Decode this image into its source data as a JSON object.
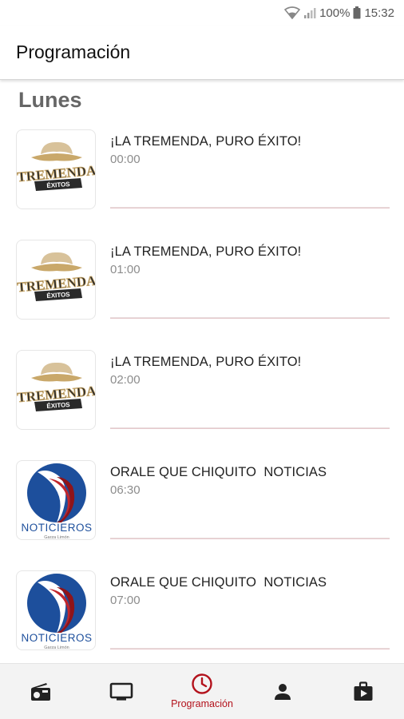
{
  "status_bar": {
    "battery": "100%",
    "time": "15:32",
    "icons": [
      "wifi-icon",
      "signal-icon",
      "battery-icon"
    ]
  },
  "app_bar": {
    "title": "Programación"
  },
  "day_heading": "Lunes",
  "programs": [
    {
      "title": "¡LA TREMENDA, PURO ÉXITO!",
      "time": "00:00",
      "logo": "tremenda-logo",
      "logo_text": "TREMENDA",
      "logo_sub": "ÉXITOS"
    },
    {
      "title": "¡LA TREMENDA, PURO ÉXITO!",
      "time": "01:00",
      "logo": "tremenda-logo",
      "logo_text": "TREMENDA",
      "logo_sub": "ÉXITOS"
    },
    {
      "title": "¡LA TREMENDA, PURO ÉXITO!",
      "time": "02:00",
      "logo": "tremenda-logo",
      "logo_text": "TREMENDA",
      "logo_sub": "ÉXITOS"
    },
    {
      "title": "ORALE QUE CHIQUITO  NOTICIAS",
      "time": "06:30",
      "logo": "noticieros-logo",
      "logo_text": "NOTICIEROS",
      "logo_sub": "Garza Limón"
    },
    {
      "title": "ORALE QUE CHIQUITO  NOTICIAS",
      "time": "07:00",
      "logo": "noticieros-logo",
      "logo_text": "NOTICIEROS",
      "logo_sub": "Garza Limón"
    }
  ],
  "bottom_nav": {
    "items": [
      {
        "icon": "radio-icon",
        "label": "",
        "active": false
      },
      {
        "icon": "tv-icon",
        "label": "",
        "active": false
      },
      {
        "icon": "clock-icon",
        "label": "Programación",
        "active": true
      },
      {
        "icon": "person-icon",
        "label": "",
        "active": false
      },
      {
        "icon": "video-bag-icon",
        "label": "",
        "active": false
      }
    ]
  },
  "colors": {
    "accent": "#b3121c",
    "divider": "#e6c9cc",
    "heading": "#666666",
    "time_text": "#8c8c8c",
    "nav_background": "#f3f3f3",
    "logo_gold": "#c9a86a",
    "logo_blue": "#1d4f9c",
    "logo_red": "#c0262c"
  }
}
